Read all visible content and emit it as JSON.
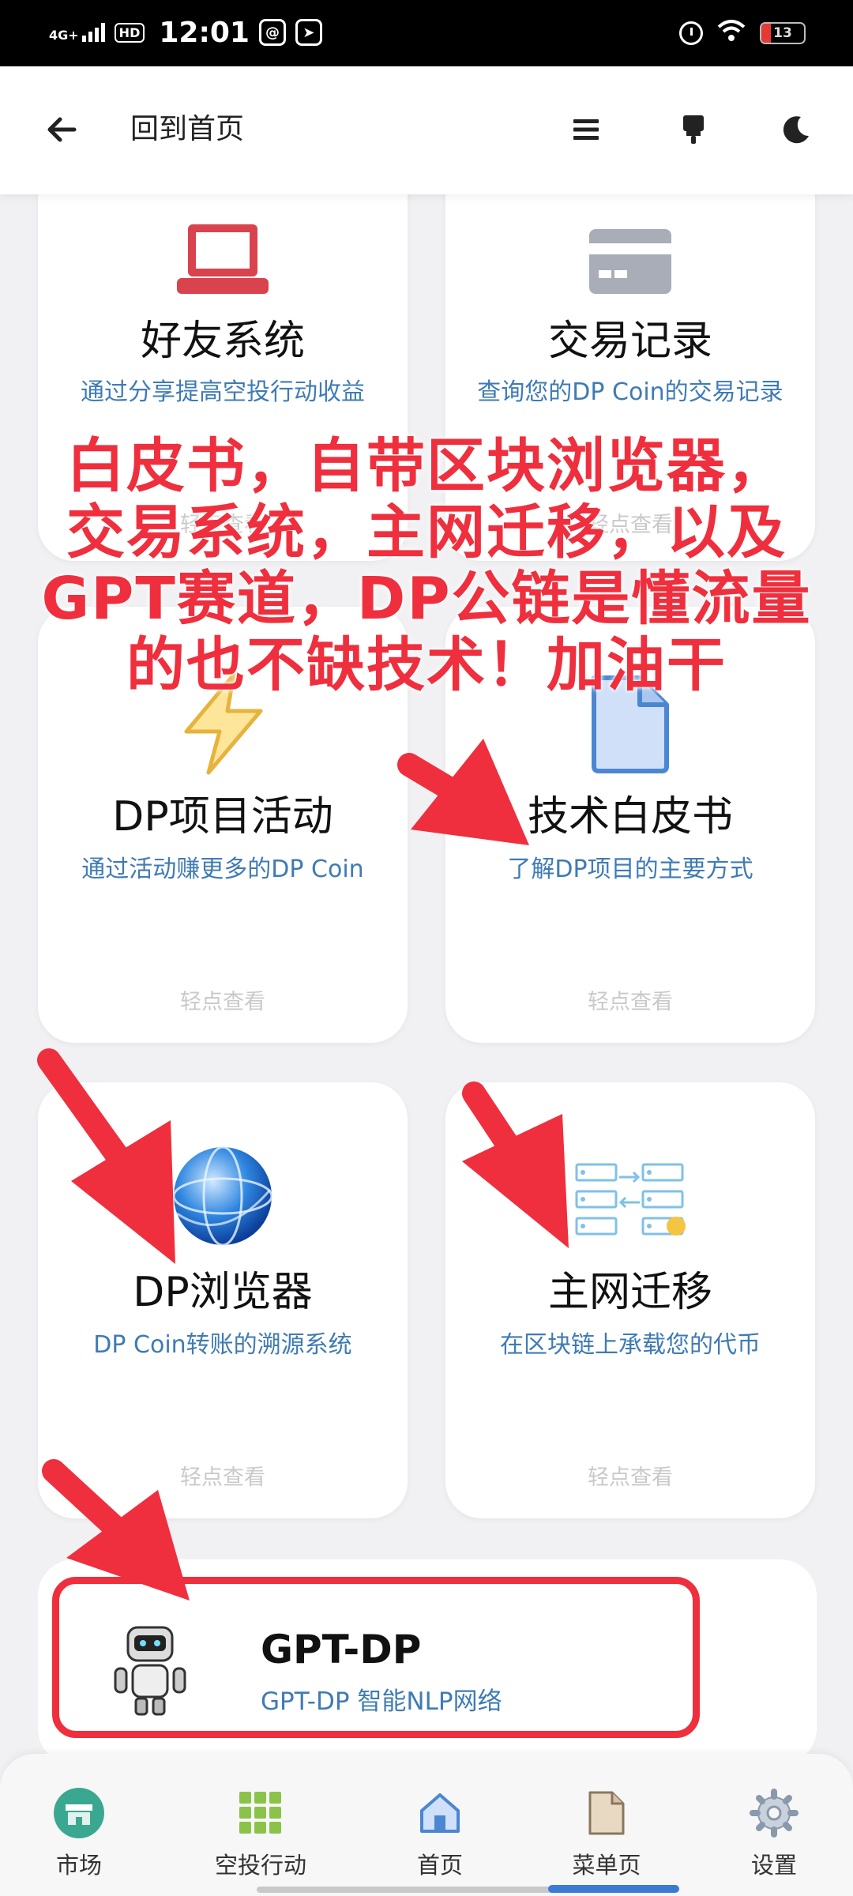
{
  "status_bar": {
    "network": "4G+",
    "hd": "HD",
    "time": "12:01",
    "battery_level": "13"
  },
  "header": {
    "back_label": "回到首页"
  },
  "cards": [
    {
      "title": "好友系统",
      "subtitle": "通过分享提高空投行动收益",
      "tap": "轻点查看",
      "icon": "laptop-icon"
    },
    {
      "title": "交易记录",
      "subtitle": "查询您的DP Coin的交易记录",
      "tap": "轻点查看",
      "icon": "credit-card-icon"
    },
    {
      "title": "DP项目活动",
      "subtitle": "通过活动赚更多的DP Coin",
      "tap": "轻点查看",
      "icon": "lightning-icon"
    },
    {
      "title": "技术白皮书",
      "subtitle": "了解DP项目的主要方式",
      "tap": "轻点查看",
      "icon": "document-icon"
    },
    {
      "title": "DP浏览器",
      "subtitle": "DP Coin转账的溯源系统",
      "tap": "轻点查看",
      "icon": "globe-icon"
    },
    {
      "title": "主网迁移",
      "subtitle": "在区块链上承载您的代币",
      "tap": "轻点查看",
      "icon": "server-migration-icon"
    }
  ],
  "gpt": {
    "title": "GPT-DP",
    "subtitle": "GPT-DP 智能NLP网络"
  },
  "overlay_text": [
    "白皮书，自带区块浏览器，",
    "交易系统，主网迁移，以及",
    "GPT赛道，DP公链是懂流量",
    "的也不缺技术！加油干"
  ],
  "bottom_nav": [
    {
      "label": "市场",
      "icon": "market-icon"
    },
    {
      "label": "空投行动",
      "icon": "grid-icon"
    },
    {
      "label": "首页",
      "icon": "home-icon"
    },
    {
      "label": "菜单页",
      "icon": "menu-page-icon"
    },
    {
      "label": "设置",
      "icon": "settings-icon"
    }
  ],
  "colors": {
    "accent_red": "#ef2f3d",
    "link_blue": "#3f7bb5",
    "laptop_red": "#d9434e",
    "card_gray": "#a8adb7"
  }
}
